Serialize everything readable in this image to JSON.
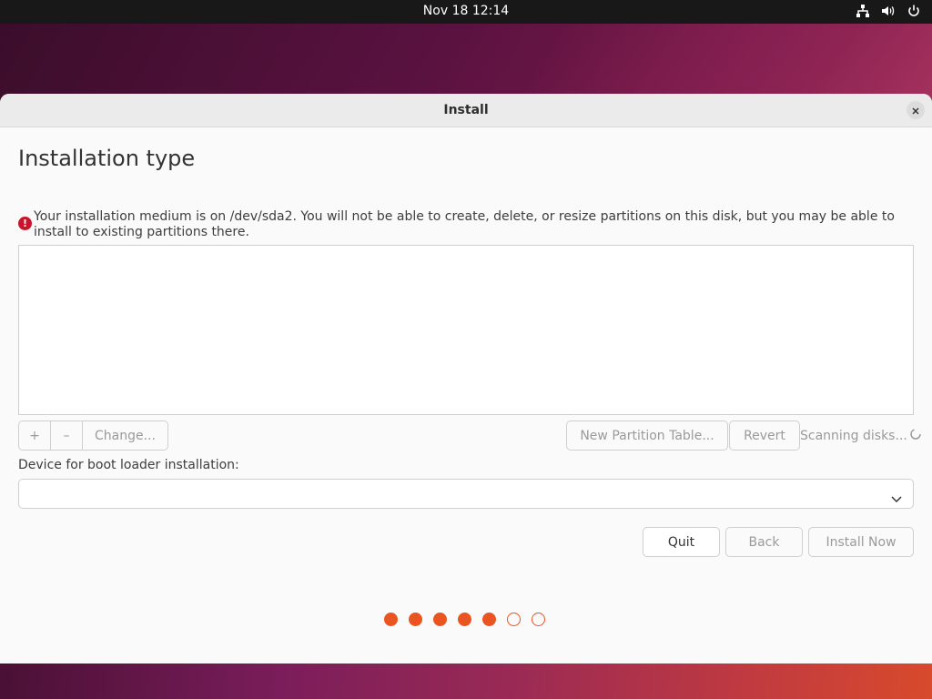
{
  "topbar": {
    "clock": "Nov 18  12:14",
    "icons": [
      "network-icon",
      "volume-icon",
      "power-icon"
    ]
  },
  "window": {
    "title": "Install",
    "page_title": "Installation type",
    "warning": "Your installation medium is on /dev/sda2. You will not be able to create, delete, or resize partitions on this disk, but you may be able to install to existing partitions there.",
    "partition_toolbar": {
      "add_label": "+",
      "remove_label": "–",
      "change_label": "Change..."
    },
    "new_partition_table_label": "New Partition Table...",
    "revert_label": "Revert",
    "scanning_text": "Scanning disks...",
    "boot_loader_label": "Device for boot loader installation:",
    "boot_loader_value": "",
    "buttons": {
      "quit": "Quit",
      "back": "Back",
      "install_now": "Install Now"
    },
    "progress": {
      "total_steps": 7,
      "completed_steps": 5
    }
  },
  "colors": {
    "accent": "#e95420",
    "warning": "#c7162b"
  }
}
